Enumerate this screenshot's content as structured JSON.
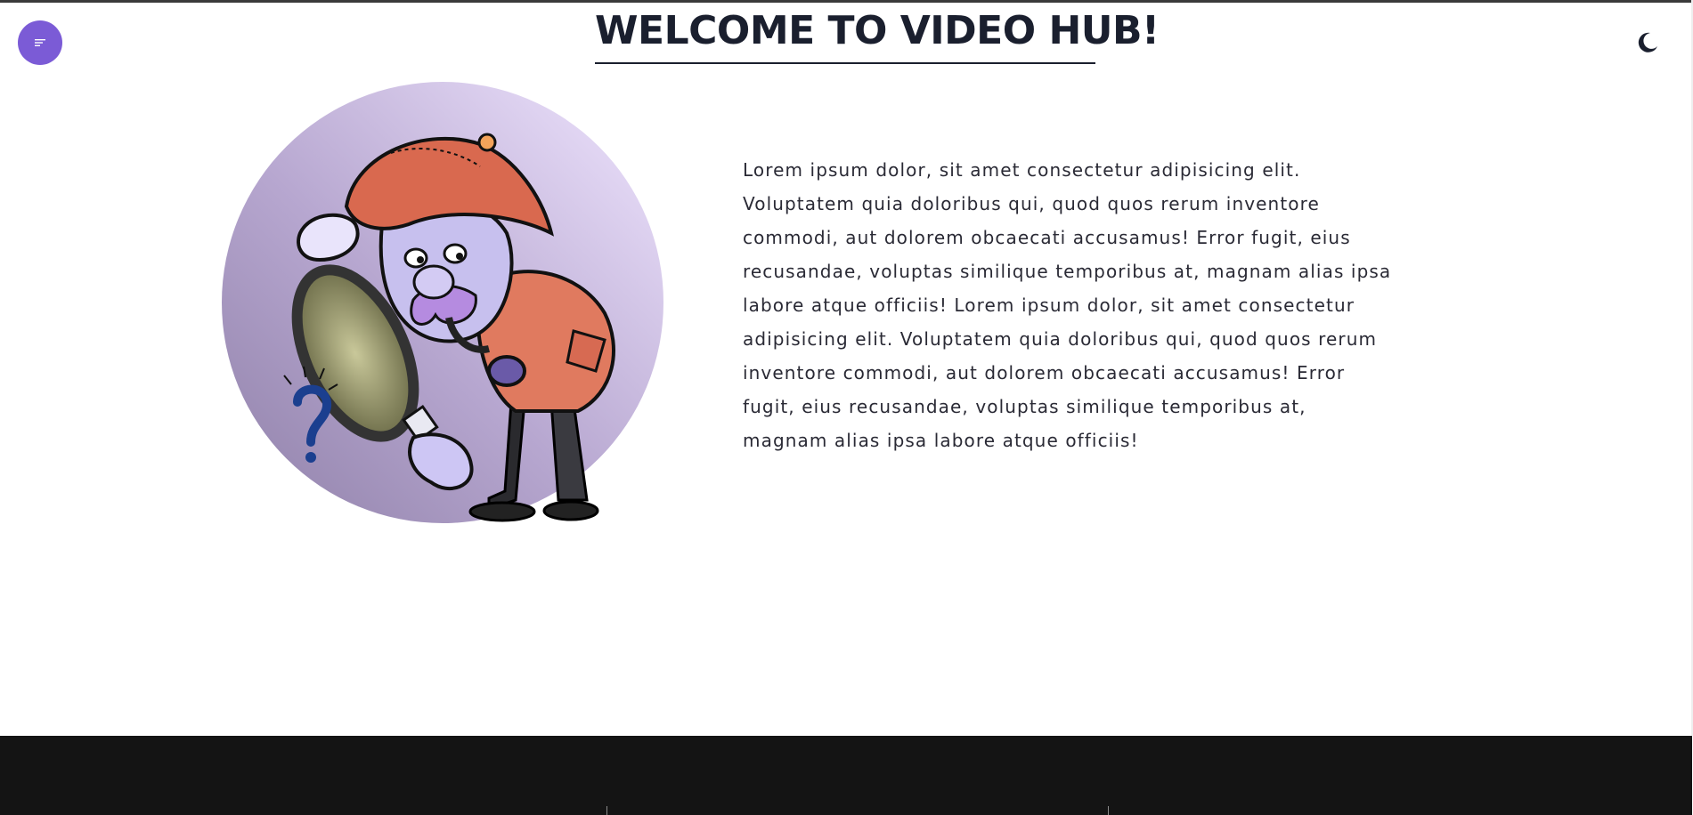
{
  "header": {
    "title": "WELCOME TO VIDEO HUB!",
    "menu_icon": "hamburger-lines-icon",
    "theme_icon": "moon-icon"
  },
  "hero": {
    "image_description_icon": "detective-with-magnifying-glass-illustration",
    "text": "Lorem ipsum dolor, sit amet consectetur adipisicing elit. Voluptatem quia doloribus qui, quod quos rerum inventore commodi, aut dolorem obcaecati accusamus! Error fugit, eius recusandae, voluptas similique temporibus at, magnam alias ipsa labore atque officiis! Lorem ipsum dolor, sit amet consectetur adipisicing elit. Voluptatem quia doloribus qui, quod quos rerum inventore commodi, aut dolorem obcaecati accusamus! Error fugit, eius recusandae, voluptas similique temporibus at, magnam alias ipsa labore atque officiis!"
  },
  "colors": {
    "accent": "#7b5bd6",
    "title_text": "#1a1f2e",
    "footer_bg": "#141414",
    "circle_light": "#ece0ff",
    "circle_dark": "#9b8ab5"
  }
}
